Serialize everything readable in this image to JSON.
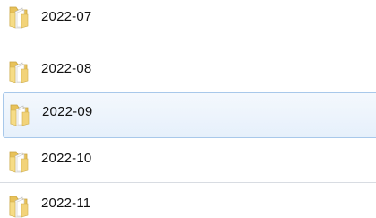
{
  "folders": [
    {
      "name": "2022-07",
      "icon": "folder-icon",
      "selected": false
    },
    {
      "name": "2022-08",
      "icon": "folder-icon",
      "selected": false
    },
    {
      "name": "2022-09",
      "icon": "folder-icon",
      "selected": true
    },
    {
      "name": "2022-10",
      "icon": "folder-icon",
      "selected": false
    },
    {
      "name": "2022-11",
      "icon": "folder-icon",
      "selected": false
    }
  ],
  "colors": {
    "selection_border": "#a8c8ea",
    "selection_fill": "#e6f0fb",
    "separator": "#d8dce2",
    "folder": "#f2d37a"
  }
}
